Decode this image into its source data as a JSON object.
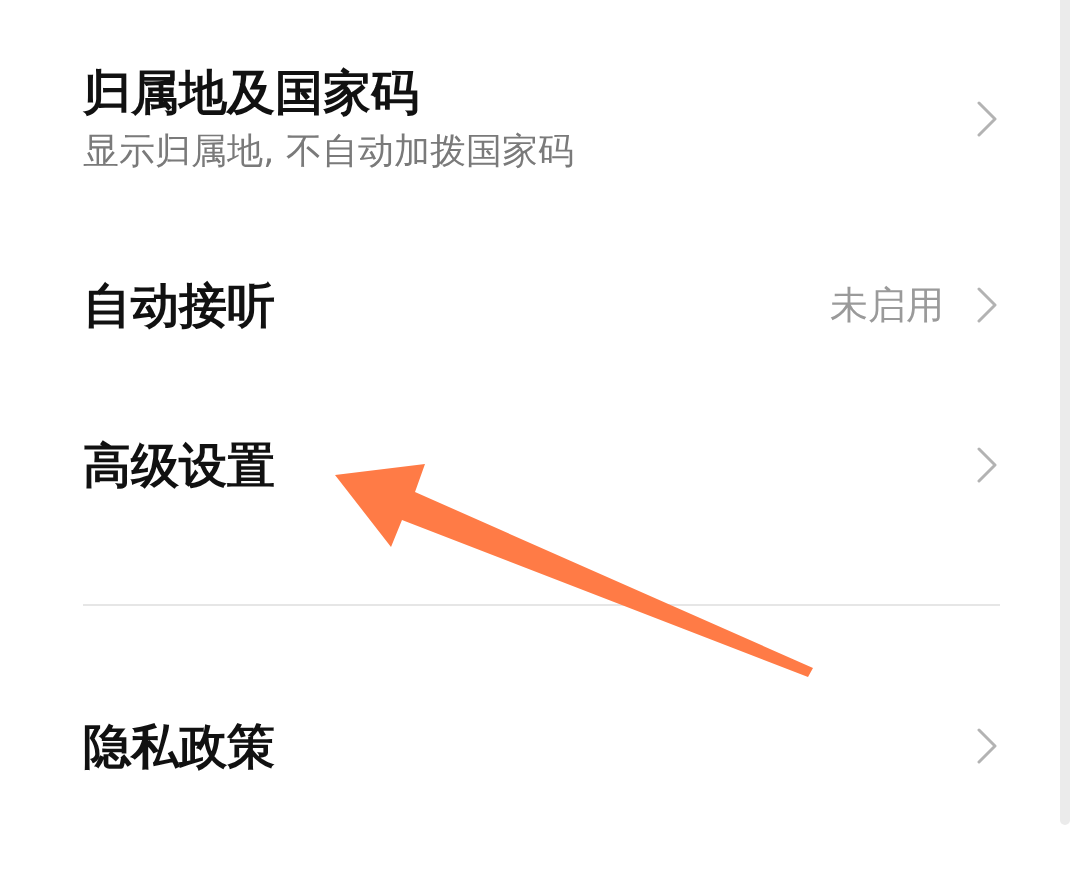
{
  "sections": [
    {
      "rows": [
        {
          "title": "归属地及国家码",
          "subtitle": "显示归属地, 不自动加拨国家码",
          "pointed_at": false
        },
        {
          "title": "自动接听",
          "value": "未启用",
          "pointed_at": false
        },
        {
          "title": "高级设置",
          "pointed_at": true
        }
      ]
    },
    {
      "rows": [
        {
          "title": "隐私政策",
          "pointed_at": false
        }
      ]
    }
  ]
}
